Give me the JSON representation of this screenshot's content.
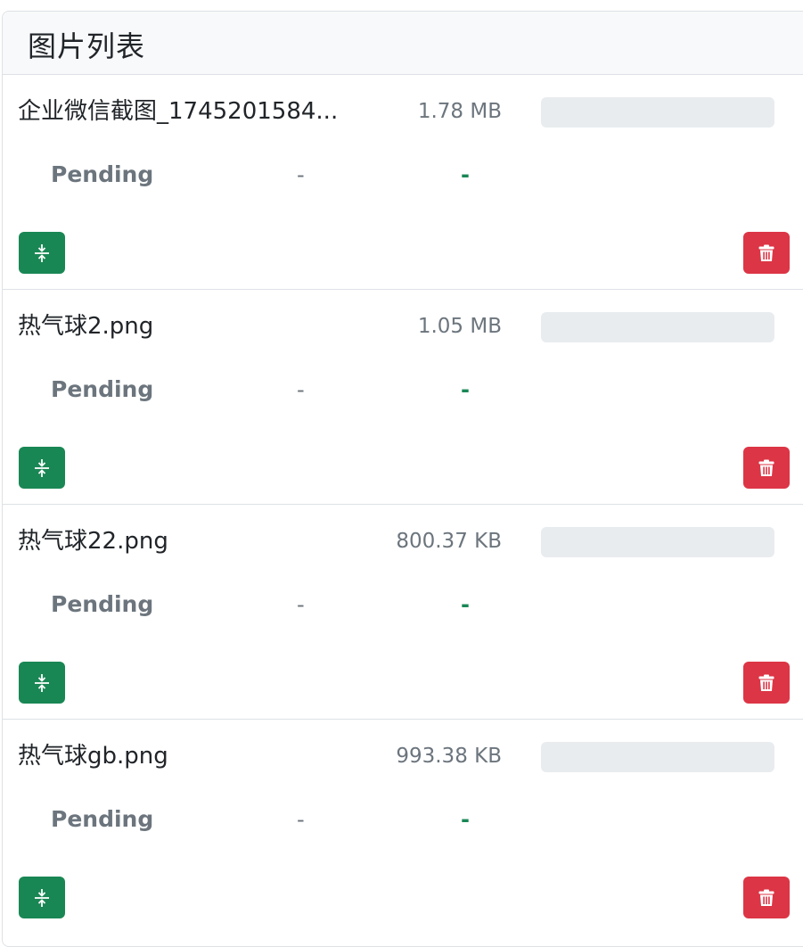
{
  "header": {
    "title": "图片列表"
  },
  "items": [
    {
      "name": "企业微信截图_1745201584...",
      "size": "1.78 MB",
      "status": "Pending",
      "compressed_size": "-",
      "ratio": "-",
      "progress": 0
    },
    {
      "name": "热气球2.png",
      "size": "1.05 MB",
      "status": "Pending",
      "compressed_size": "-",
      "ratio": "-",
      "progress": 0
    },
    {
      "name": "热气球22.png",
      "size": "800.37 KB",
      "status": "Pending",
      "compressed_size": "-",
      "ratio": "-",
      "progress": 0
    },
    {
      "name": "热气球gb.png",
      "size": "993.38 KB",
      "status": "Pending",
      "compressed_size": "-",
      "ratio": "-",
      "progress": 0
    }
  ],
  "icons": {
    "compress": "compress-icon",
    "delete": "trash-icon"
  },
  "colors": {
    "compress_button": "#198754",
    "delete_button": "#dc3545",
    "progress_track": "#e9ecef",
    "ratio_text": "#198754"
  }
}
